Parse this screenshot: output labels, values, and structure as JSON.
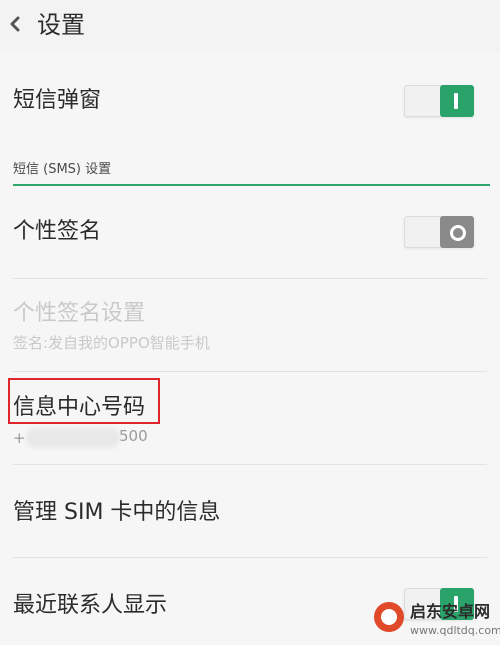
{
  "header": {
    "title": "设置",
    "back_icon": "chevron-left-icon"
  },
  "items": [
    {
      "title": "短信弹窗",
      "toggle": "on"
    },
    {
      "title": "个性签名",
      "toggle": "off"
    },
    {
      "title": "个性签名设置",
      "subtitle": "签名:发自我的OPPO智能手机",
      "state": "disabled"
    },
    {
      "title": "信息中心号码",
      "subtitle_prefix": "+",
      "subtitle_suffix": "500",
      "highlighted": true
    },
    {
      "title": "管理 SIM 卡中的信息"
    },
    {
      "title": "最近联系人显示",
      "toggle": "on"
    }
  ],
  "section": {
    "label": "短信 (SMS) 设置"
  },
  "colors": {
    "accent": "#2aa36a",
    "highlight_border": "#e0262a",
    "toggle_off_knob": "#8a8a8a"
  },
  "watermark": {
    "name": "启东安卓网",
    "url": "www.qdltdq.com"
  }
}
